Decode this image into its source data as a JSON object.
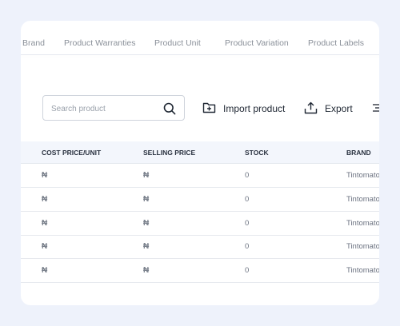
{
  "tabs": [
    "Brand",
    "Product Warranties",
    "Product Unit",
    "Product Variation",
    "Product Labels"
  ],
  "toolbar": {
    "search_placeholder": "Search product",
    "import_label": "Import product",
    "export_label": "Export"
  },
  "table": {
    "columns": [
      "COST PRICE/UNIT",
      "SELLING PRICE",
      "STOCK",
      "BRAND"
    ],
    "rows": [
      {
        "cost": "₦",
        "selling": "₦",
        "stock": "0",
        "brand": "Tintomato"
      },
      {
        "cost": "₦",
        "selling": "₦",
        "stock": "0",
        "brand": "Tintomato"
      },
      {
        "cost": "₦",
        "selling": "₦",
        "stock": "0",
        "brand": "Tintomato"
      },
      {
        "cost": "₦",
        "selling": "₦",
        "stock": "0",
        "brand": "Tintomato"
      },
      {
        "cost": "₦",
        "selling": "₦",
        "stock": "0",
        "brand": "Tintomato"
      }
    ]
  },
  "icons": {
    "search": "search-icon",
    "import": "folder-plus-icon",
    "export": "upload-icon",
    "filter": "filter-icon"
  }
}
